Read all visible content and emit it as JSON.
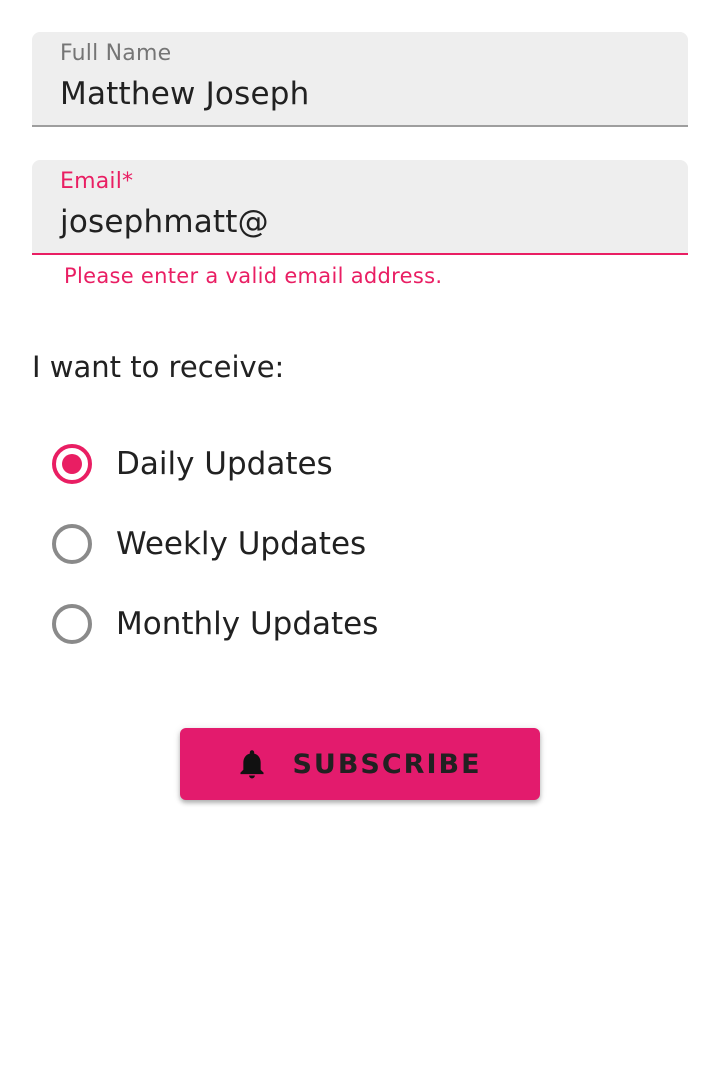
{
  "form": {
    "full_name": {
      "label": "Full Name",
      "value": "Matthew Joseph"
    },
    "email": {
      "label": "Email*",
      "value": "josephmatt@",
      "error": "Please enter a valid email address."
    },
    "receive": {
      "label": "I want to receive:",
      "options": [
        {
          "label": "Daily Updates",
          "selected": true
        },
        {
          "label": "Weekly Updates",
          "selected": false
        },
        {
          "label": "Monthly Updates",
          "selected": false
        }
      ]
    },
    "subscribe_button": {
      "label": "SUBSCRIBE",
      "icon": "bell-icon"
    }
  },
  "colors": {
    "accent": "#e91e63",
    "button": "#e31b6d",
    "field_bg": "#eeeeee",
    "text": "#212121"
  }
}
